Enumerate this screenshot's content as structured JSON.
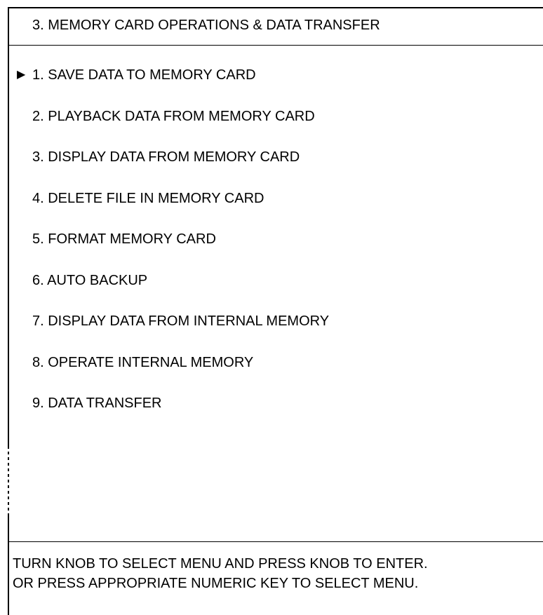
{
  "menu": {
    "title": "3. MEMORY CARD OPERATIONS & DATA TRANSFER",
    "selected_index": 0,
    "cursor_icon": "triangle-right",
    "items": [
      {
        "label": "1. SAVE DATA TO MEMORY CARD"
      },
      {
        "label": "2. PLAYBACK DATA FROM MEMORY CARD"
      },
      {
        "label": "3. DISPLAY DATA FROM MEMORY CARD"
      },
      {
        "label": "4. DELETE FILE IN MEMORY CARD"
      },
      {
        "label": "5. FORMAT MEMORY CARD"
      },
      {
        "label": "6. AUTO BACKUP"
      },
      {
        "label": "7. DISPLAY DATA FROM INTERNAL MEMORY"
      },
      {
        "label": "8. OPERATE INTERNAL MEMORY"
      },
      {
        "label": "9. DATA TRANSFER"
      }
    ]
  },
  "instructions": {
    "line1": "TURN KNOB TO SELECT MENU AND PRESS KNOB TO ENTER.",
    "line2": "OR PRESS APPROPRIATE NUMERIC KEY TO SELECT MENU."
  }
}
